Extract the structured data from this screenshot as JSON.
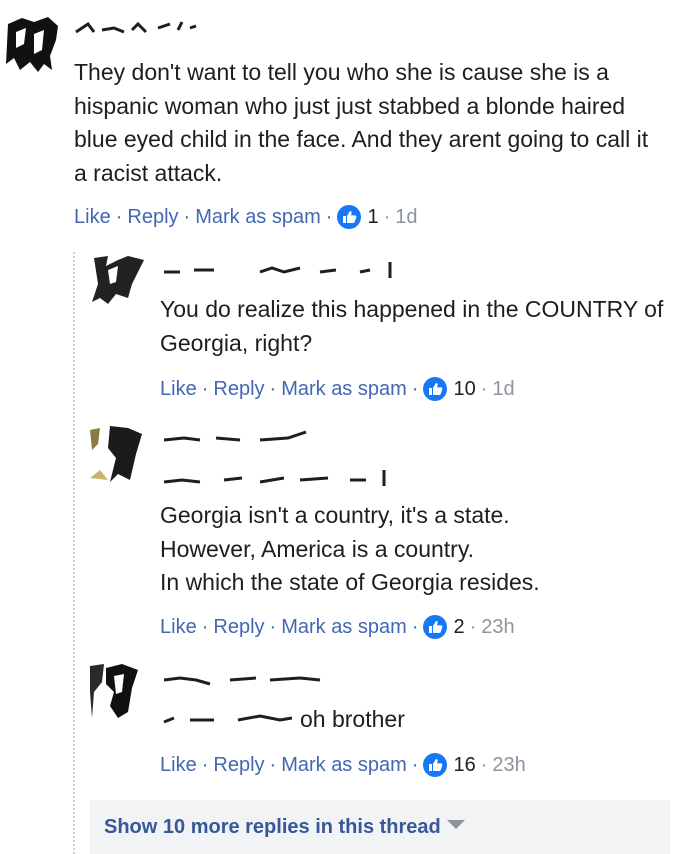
{
  "comments": [
    {
      "paragraphs": [
        "They don't want to tell you who she is cause she is a hispanic woman who just just stabbed a blonde haired blue eyed child in the face. And they arent going to call it a racist attack."
      ],
      "actions": {
        "like": "Like",
        "reply": "Reply",
        "spam": "Mark as spam",
        "reactions": "1",
        "time": "1d"
      }
    },
    {
      "paragraphs": [
        "You do realize this happened in the COUNTRY of Georgia, right?"
      ],
      "actions": {
        "like": "Like",
        "reply": "Reply",
        "spam": "Mark as spam",
        "reactions": "10",
        "time": "1d"
      }
    },
    {
      "paragraphs": [
        "Georgia isn't a country, it's a state.",
        "However, America is a country.",
        "In which the state of Georgia resides."
      ],
      "actions": {
        "like": "Like",
        "reply": "Reply",
        "spam": "Mark as spam",
        "reactions": "2",
        "time": "23h"
      }
    },
    {
      "paragraphs": [
        "oh brother"
      ],
      "actions": {
        "like": "Like",
        "reply": "Reply",
        "spam": "Mark as spam",
        "reactions": "16",
        "time": "23h"
      }
    }
  ],
  "thread": {
    "more_replies": "Show 10 more replies in this thread"
  },
  "colors": {
    "link": "#4267b2",
    "muted": "#8d949e",
    "text": "#1c1e21",
    "like_badge": "#1877f2"
  },
  "icons": {
    "reaction": "thumbs-up-icon",
    "expand": "caret-down-icon"
  }
}
